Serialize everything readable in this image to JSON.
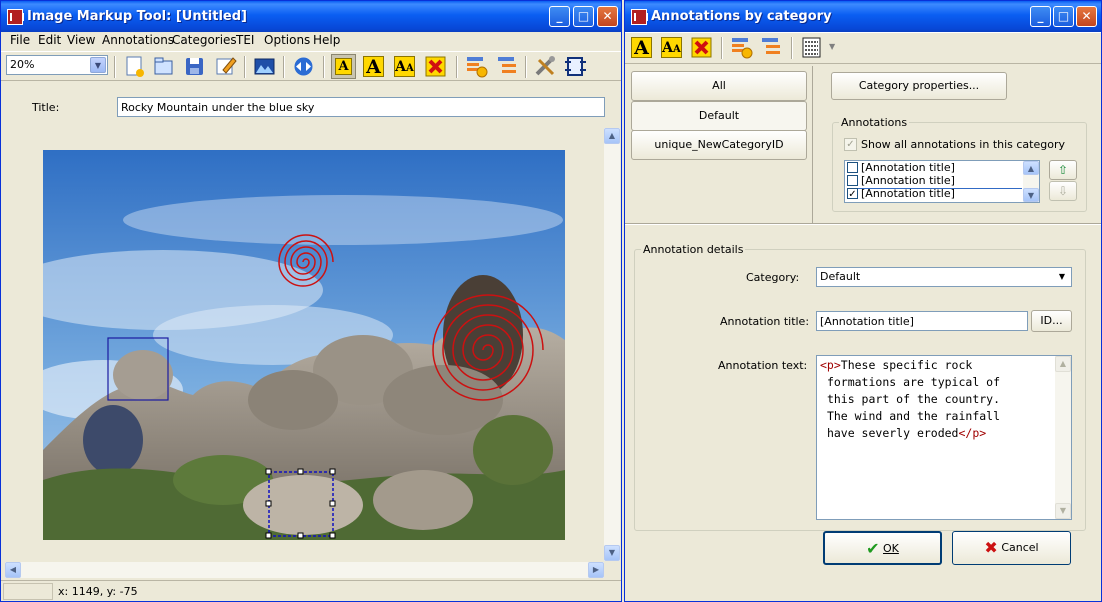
{
  "left_window": {
    "title": "Image Markup Tool: [Untitled]",
    "menu": [
      "File",
      "Edit",
      "View",
      "Annotations",
      "Categories",
      "TEI",
      "Options",
      "Help"
    ],
    "zoom": {
      "value": "20%",
      "options": [
        "20%"
      ]
    },
    "title_label": "Title:",
    "title_value": "Rocky Mountain under the blue sky",
    "status": "x: 1149, y: -75",
    "toolbar_icons": [
      "new-file-icon",
      "open-file-icon",
      "save-icon",
      "edit-icon",
      "load-image-icon",
      "move-icon",
      "annotation-text-icon",
      "annotation-a-icon",
      "annotation-aa-icon",
      "annotation-delete-icon",
      "category-add-icon",
      "category-list-icon",
      "tools-icon",
      "settings-icon"
    ]
  },
  "right_window": {
    "title": "Annotations by category",
    "categories": [
      "All",
      "Default",
      "unique_NewCategoryID"
    ],
    "selected_category": "Default",
    "category_properties_button": "Category properties...",
    "annotations_group_label": "Annotations",
    "show_all_label": "Show all annotations in this category",
    "annotation_items": [
      {
        "label": "[Annotation title]",
        "checked": false
      },
      {
        "label": "[Annotation title]",
        "checked": false
      },
      {
        "label": "[Annotation title]",
        "checked": true
      }
    ],
    "details_group_label": "Annotation details",
    "category_label": "Category:",
    "category_value": "Default",
    "annotation_title_label": "Annotation title:",
    "annotation_title_value": "[Annotation title]",
    "id_button": "ID...",
    "annotation_text_label": "Annotation text:",
    "annotation_text": {
      "open_tag": "<p>",
      "lines": [
        "These specific rock",
        "formations are typical of",
        "this part of the country.",
        "The wind and the rainfall",
        "have severly eroded"
      ],
      "close_tag": "</p>"
    },
    "ok_button": "OK",
    "cancel_button": "Cancel"
  },
  "colors": {
    "titlebar": "#0a5ef2",
    "annotation_spiral": "#cc1111",
    "annotation_box": "#1a1aa0",
    "ok_check": "#1f9a1f",
    "cancel_x": "#cc1111"
  }
}
